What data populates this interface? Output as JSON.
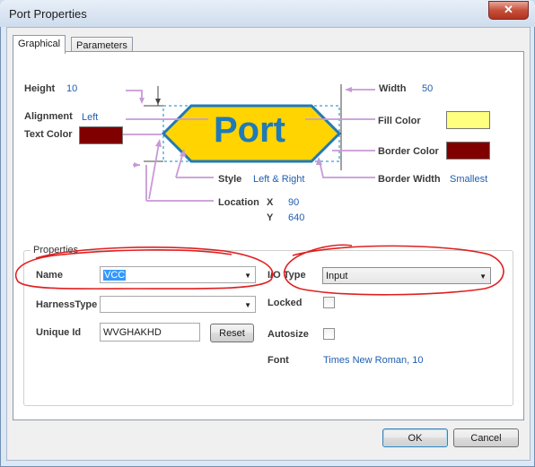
{
  "window": {
    "title": "Port Properties",
    "close_glyph": "✕"
  },
  "tabs": [
    {
      "label": "Graphical",
      "active": true
    },
    {
      "label": "Parameters",
      "active": false
    }
  ],
  "preview": {
    "port_text": "Port",
    "height": {
      "label": "Height",
      "value": "10"
    },
    "alignment": {
      "label": "Alignment",
      "value": "Left"
    },
    "text_color": {
      "label": "Text Color",
      "color": "#800000"
    },
    "width": {
      "label": "Width",
      "value": "50"
    },
    "fill_color": {
      "label": "Fill Color",
      "color": "#ffff80"
    },
    "border_color": {
      "label": "Border Color",
      "color": "#800000"
    },
    "border_width": {
      "label": "Border Width",
      "value": "Smallest"
    },
    "style": {
      "label": "Style",
      "value": "Left & Right"
    },
    "location": {
      "label": "Location",
      "x_label": "X",
      "x_value": "90",
      "y_label": "Y",
      "y_value": "640"
    },
    "colors": {
      "port_fill": "#ffd400",
      "port_border": "#1f7ab8",
      "port_text": "#1f7ab8",
      "callout": "#c79ad6"
    }
  },
  "properties": {
    "group_title": "Properties",
    "name": {
      "label": "Name",
      "value": "VCC"
    },
    "harness_type": {
      "label": "HarnessType",
      "value": ""
    },
    "unique_id": {
      "label": "Unique Id",
      "value": "WVGHAKHD"
    },
    "reset_label": "Reset",
    "io_type": {
      "label": "I/O Type",
      "value": "Input"
    },
    "locked": {
      "label": "Locked",
      "checked": false
    },
    "autosize": {
      "label": "Autosize",
      "checked": false
    },
    "font": {
      "label": "Font",
      "value": "Times New Roman, 10"
    }
  },
  "footer": {
    "ok_label": "OK",
    "cancel_label": "Cancel"
  }
}
